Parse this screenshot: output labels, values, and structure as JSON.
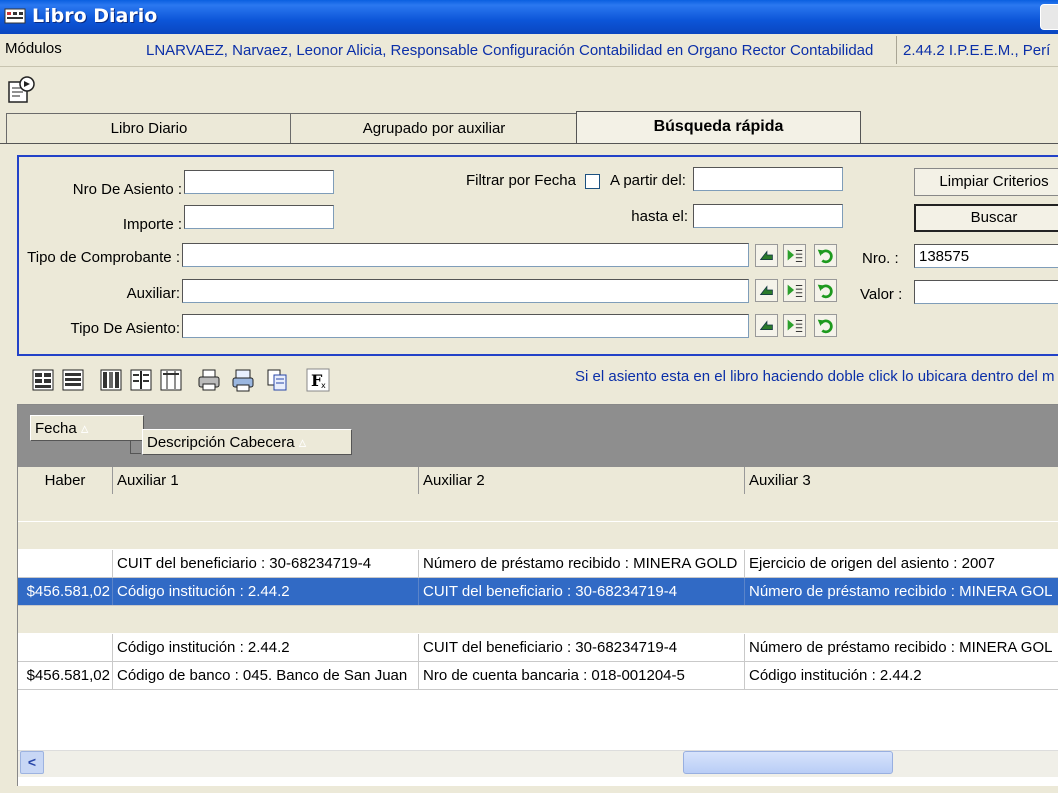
{
  "window": {
    "title": "Libro Diario"
  },
  "info_bar": {
    "modules_label": "Módulos",
    "user_info": "LNARVAEZ, Narvaez, Leonor Alicia, Responsable Configuración Contabilidad en Organo Rector Contabilidad",
    "entity_info": "2.44.2 I.P.E.E.M., Perí"
  },
  "tabs": [
    {
      "label": "Libro Diario",
      "active": false
    },
    {
      "label": "Agrupado por auxiliar",
      "active": false
    },
    {
      "label": "Búsqueda rápida",
      "active": true
    }
  ],
  "search": {
    "nro_asiento_label": "Nro De Asiento :",
    "nro_asiento_value": "",
    "importe_label": "Importe :",
    "importe_value": "",
    "filtrar_fecha_label": "Filtrar por Fecha",
    "filtrar_fecha_checked": false,
    "a_partir_label": "A partir del:",
    "a_partir_value": "",
    "hasta_label": "hasta el:",
    "hasta_value": "",
    "tipo_comprobante_label": "Tipo de Comprobante :",
    "tipo_comprobante_value": "",
    "auxiliar_label": "Auxiliar:",
    "auxiliar_value": "",
    "tipo_asiento_label": "Tipo De Asiento:",
    "tipo_asiento_value": "",
    "nro_label": "Nro. :",
    "nro_value": "138575",
    "valor_label": "Valor :",
    "valor_value": "",
    "limpiar_label": "Limpiar Criterios",
    "buscar_label": "Buscar"
  },
  "hint": "Si el asiento esta en el libro haciendo doble click lo ubicara dentro del m",
  "grid": {
    "group_by": [
      {
        "label": "Fecha",
        "sort_glyph": "▵"
      },
      {
        "label": "Descripción Cabecera",
        "sort_glyph": "▵"
      }
    ],
    "columns": [
      "Haber",
      "Auxiliar 1",
      "Auxiliar 2",
      "Auxiliar 3"
    ],
    "rows": [
      {
        "kind": "group",
        "cells": [
          "",
          "",
          "",
          ""
        ]
      },
      {
        "kind": "group",
        "cells": [
          "",
          "",
          "",
          ""
        ]
      },
      {
        "kind": "data",
        "cells": [
          "",
          "CUIT del beneficiario : 30-68234719-4",
          "Número de préstamo recibido : MINERA GOLD",
          "Ejercicio de origen del asiento : 2007"
        ]
      },
      {
        "kind": "selected",
        "cells": [
          "$456.581,02",
          "Código institución  : 2.44.2",
          "CUIT del beneficiario : 30-68234719-4",
          "Número de préstamo recibido : MINERA GOL"
        ]
      },
      {
        "kind": "group",
        "cells": [
          "",
          "",
          "",
          ""
        ]
      },
      {
        "kind": "data",
        "cells": [
          "",
          "Código institución  : 2.44.2",
          "CUIT del beneficiario : 30-68234719-4",
          "Número de préstamo recibido : MINERA GOL"
        ]
      },
      {
        "kind": "data",
        "cells": [
          "$456.581,02",
          "Código de banco : 045. Banco de San Juan",
          "Nro de cuenta bancaria : 018-001204-5",
          "Código institución  : 2.44.2"
        ]
      }
    ]
  },
  "scrollbar": {
    "left_arrow": "<"
  },
  "colors": {
    "title_bar": "#0c55d8",
    "selection": "#316ac5",
    "link_text": "#0b2fa8",
    "panel_border": "#2342c8"
  }
}
